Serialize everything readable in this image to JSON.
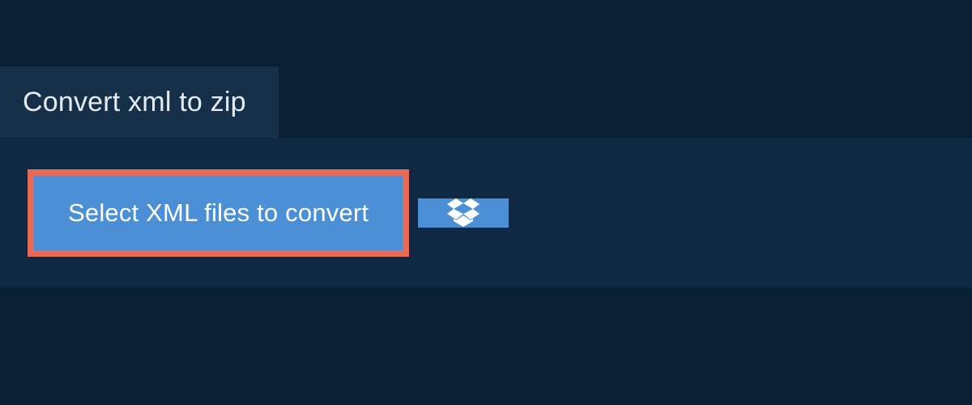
{
  "header": {
    "tab_label": "Convert xml to zip"
  },
  "actions": {
    "select_files_label": "Select XML files to convert",
    "cloud_source_icon": "dropbox-icon"
  },
  "colors": {
    "page_bg": "#0a1f33",
    "panel_bg": "#0f2843",
    "tab_bg": "#16304a",
    "button_bg": "#4b90d6",
    "highlight_border": "#e46a5a",
    "text_light": "#e6ecf2",
    "text_on_button": "#ffffff"
  }
}
